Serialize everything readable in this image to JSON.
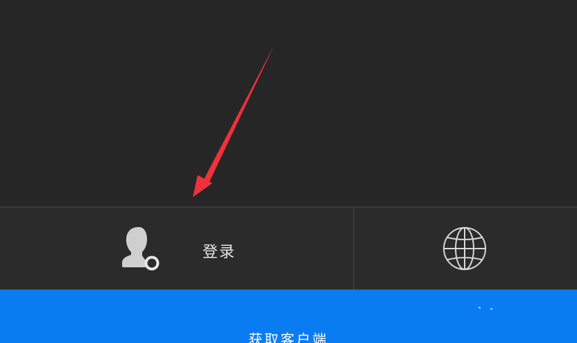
{
  "login": {
    "label": "登录",
    "icon": "user-settings-icon"
  },
  "language": {
    "icon": "globe-icon"
  },
  "get_client": {
    "label": "获取客户端"
  },
  "annotation": {
    "type": "arrow",
    "color": "#f0313b"
  },
  "colors": {
    "background": "#262626",
    "bar": "#2b2b2b",
    "accent": "#0a7cf2",
    "text": "#e6e6e6"
  }
}
